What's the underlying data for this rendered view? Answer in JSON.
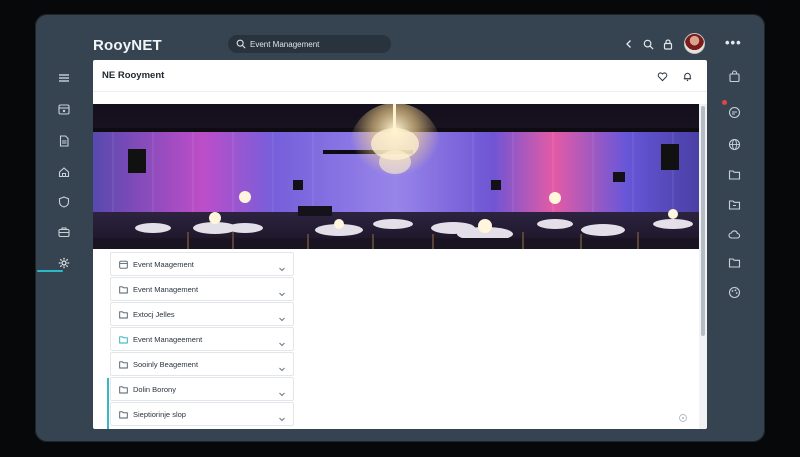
{
  "app": {
    "brand": "RooyNET"
  },
  "search": {
    "value": "Event Management"
  },
  "panel": {
    "title": "NE Rooyment"
  },
  "list": [
    {
      "label": "Event Maagement",
      "icon": "calendar-icon"
    },
    {
      "label": "Event Management",
      "icon": "folder-icon"
    },
    {
      "label": "Extocj Jelles",
      "icon": "folder-icon"
    },
    {
      "label": "Event Manageement",
      "icon": "link-icon"
    },
    {
      "label": "Sooinly Beagement",
      "icon": "folder-icon"
    },
    {
      "label": "Dolin Borony",
      "icon": "folder-icon"
    },
    {
      "label": "Sieptiorinje slop",
      "icon": "folder-icon"
    }
  ],
  "colors": {
    "frame": "#364451",
    "accent": "#2bb9c9",
    "notification": "#e24545"
  }
}
